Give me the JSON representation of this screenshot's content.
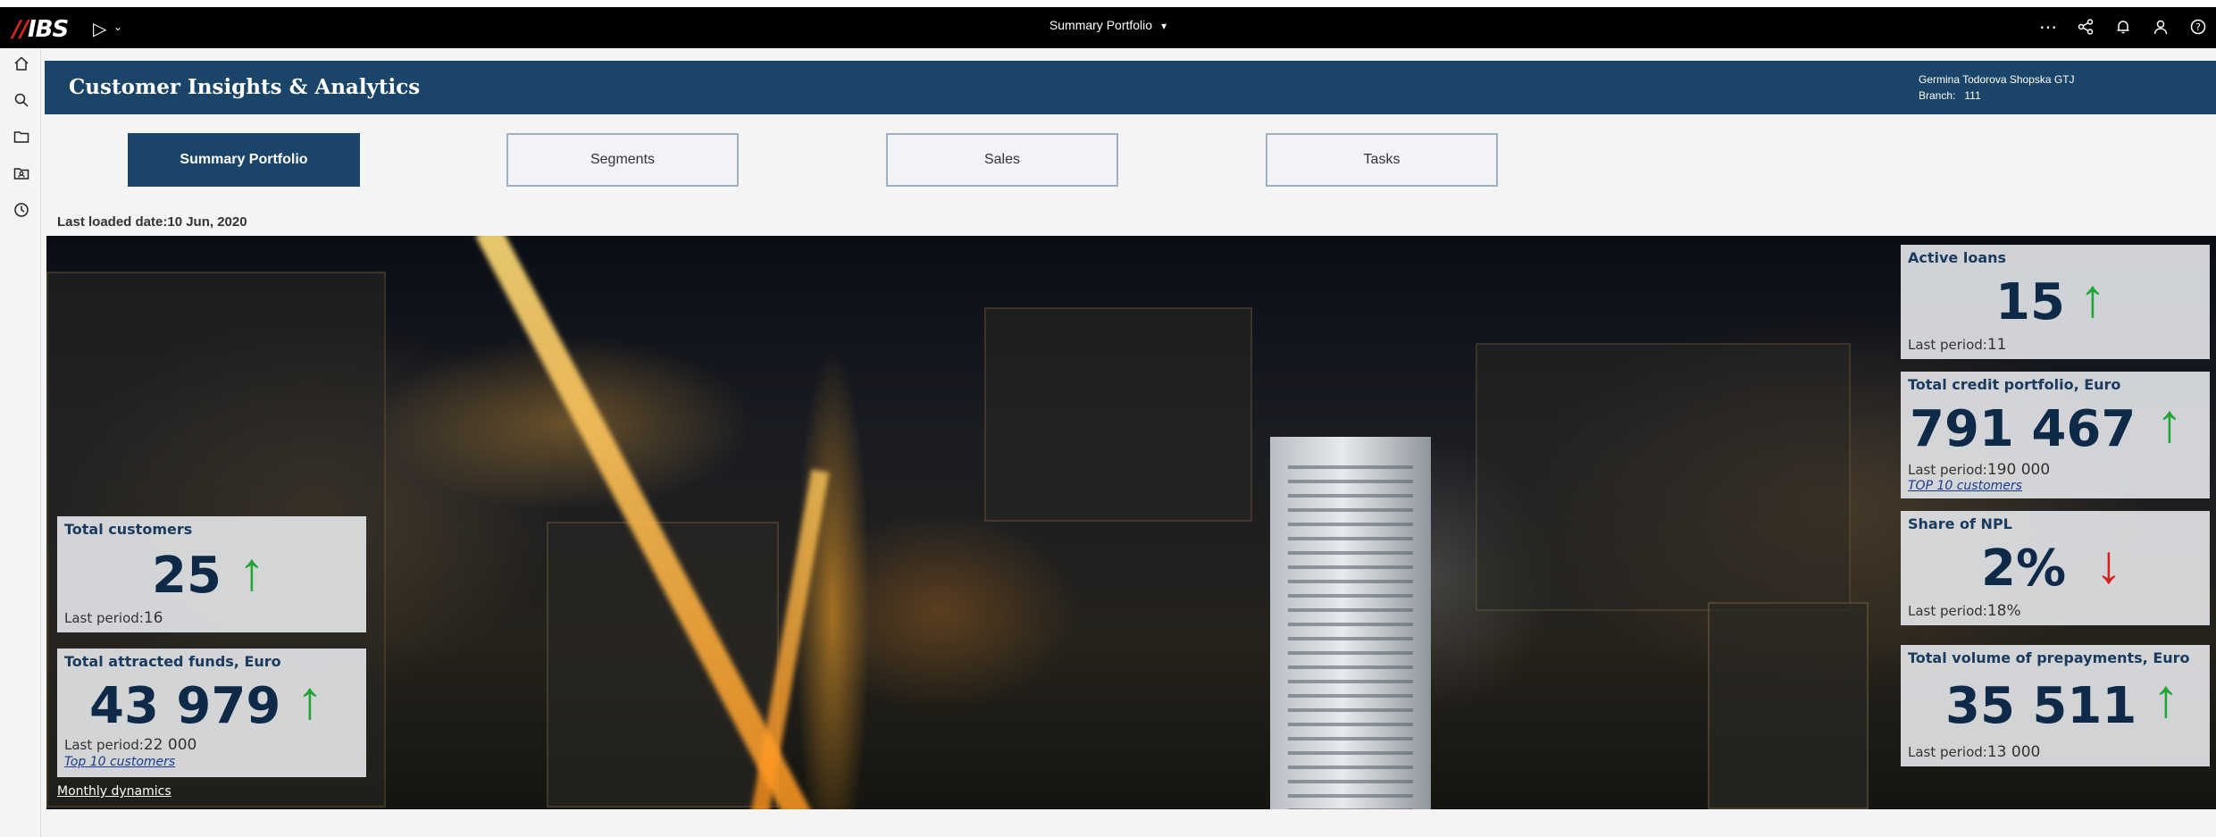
{
  "topbar": {
    "logo": "IBS",
    "title": "Summary Portfolio",
    "icons": [
      "play-icon",
      "more-icon",
      "share-icon",
      "bell-icon",
      "user-icon",
      "help-icon"
    ]
  },
  "sidenav": [
    "home-icon",
    "search-icon",
    "folder-icon",
    "folder-user-icon",
    "clock-icon"
  ],
  "header": {
    "title": "Customer Insights & Analytics",
    "user": "Germina Todorova Shopska GTJ",
    "branch_label": "Branch:",
    "branch_value": "111"
  },
  "tabs": [
    {
      "label": "Summary Portfolio",
      "active": true
    },
    {
      "label": "Segments",
      "active": false
    },
    {
      "label": "Sales",
      "active": false
    },
    {
      "label": "Tasks",
      "active": false
    }
  ],
  "last_loaded": "Last loaded date:10 Jun, 2020",
  "kpis": {
    "total_customers": {
      "label": "Total customers",
      "value": "25",
      "trend": "up",
      "last_label": "Last period:",
      "last_value": "16"
    },
    "total_attracted": {
      "label": "Total attracted funds, Euro",
      "value": "43 979",
      "trend": "up",
      "last_label": "Last period:",
      "last_value": "22 000",
      "link": "Top 10 customers"
    },
    "active_loans": {
      "label": "Active loans",
      "value": "15",
      "trend": "up",
      "last_label": "Last period:",
      "last_value": "11"
    },
    "total_credit": {
      "label": "Total credit portfolio, Euro",
      "value": "791 467",
      "trend": "up",
      "last_label": "Last period:",
      "last_value": "190 000",
      "link": "TOP 10 customers"
    },
    "share_npl": {
      "label": "Share of NPL",
      "value": "2%",
      "trend": "down",
      "last_label": "Last period:",
      "last_value": "18%"
    },
    "prepayments": {
      "label": "Total volume of prepayments, Euro",
      "value": "35 511",
      "trend": "up",
      "last_label": "Last period:",
      "last_value": "13 000"
    }
  },
  "monthly_link": "Monthly dynamics",
  "colors": {
    "header": "#1a4468",
    "up": "#21a336",
    "down": "#d61f1f"
  }
}
